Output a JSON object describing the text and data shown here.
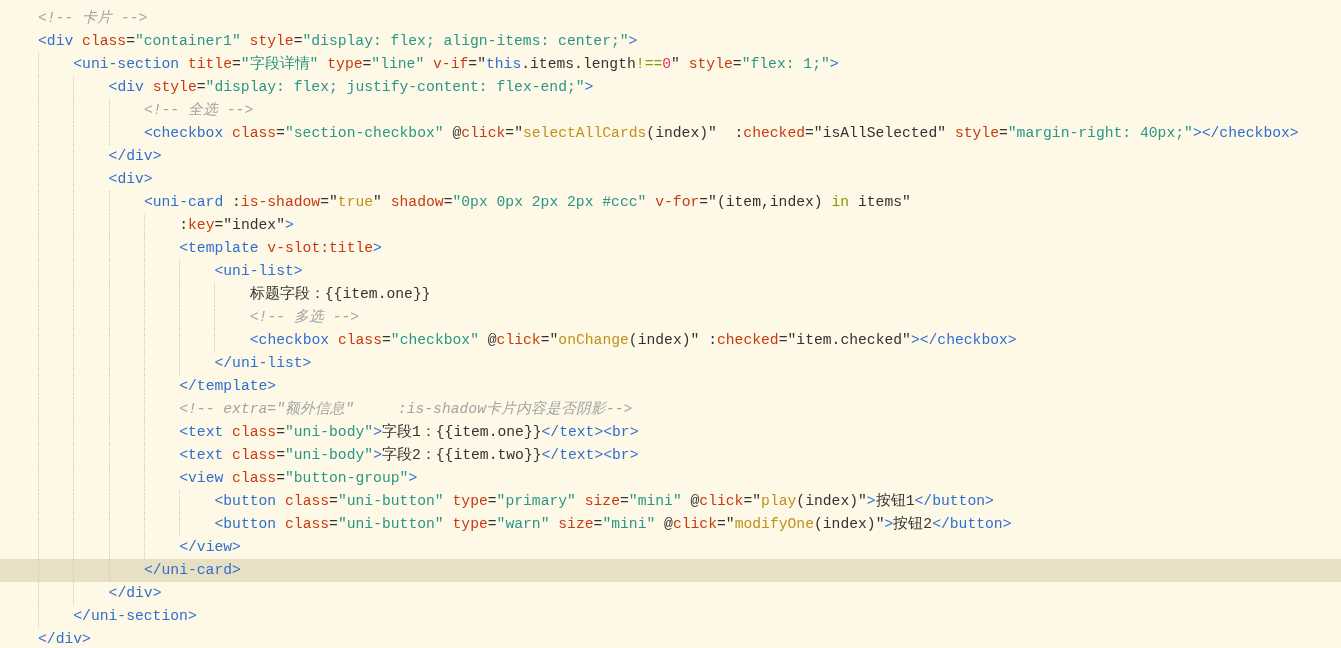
{
  "editor": {
    "lines": [
      {
        "t": [
          {
            "kind": "comment",
            "text": "<!-- 卡片 -->"
          }
        ]
      },
      {
        "t": [
          {
            "kind": "tag",
            "text": "<div"
          },
          {
            "kind": "attr",
            "text": " class"
          },
          {
            "kind": "plain",
            "text": "="
          },
          {
            "kind": "str",
            "text": "\"container1\""
          },
          {
            "kind": "attr",
            "text": " style"
          },
          {
            "kind": "plain",
            "text": "="
          },
          {
            "kind": "str",
            "text": "\"display: flex; align-items: center;\""
          },
          {
            "kind": "tag",
            "text": ">"
          }
        ],
        "children": [
          {
            "t": [
              {
                "kind": "tag",
                "text": "<uni-section"
              },
              {
                "kind": "attr",
                "text": " title"
              },
              {
                "kind": "plain",
                "text": "="
              },
              {
                "kind": "str",
                "text": "\"字段详情\""
              },
              {
                "kind": "attr",
                "text": " type"
              },
              {
                "kind": "plain",
                "text": "="
              },
              {
                "kind": "str",
                "text": "\"line\""
              },
              {
                "kind": "attr",
                "text": " v-if"
              },
              {
                "kind": "plain",
                "text": "=\""
              },
              {
                "kind": "this",
                "text": "this"
              },
              {
                "kind": "plain",
                "text": ".items.length"
              },
              {
                "kind": "kw",
                "text": "!=="
              },
              {
                "kind": "num",
                "text": "0"
              },
              {
                "kind": "plain",
                "text": "\""
              },
              {
                "kind": "attr",
                "text": " style"
              },
              {
                "kind": "plain",
                "text": "="
              },
              {
                "kind": "str",
                "text": "\"flex: 1;\""
              },
              {
                "kind": "tag",
                "text": ">"
              }
            ],
            "children": [
              {
                "t": [
                  {
                    "kind": "tag",
                    "text": "<div"
                  },
                  {
                    "kind": "attr",
                    "text": " style"
                  },
                  {
                    "kind": "plain",
                    "text": "="
                  },
                  {
                    "kind": "str",
                    "text": "\"display: flex; justify-content: flex-end;\""
                  },
                  {
                    "kind": "tag",
                    "text": ">"
                  }
                ],
                "children": [
                  {
                    "t": [
                      {
                        "kind": "comment",
                        "text": "<!-- 全选 -->"
                      }
                    ]
                  },
                  {
                    "t": [
                      {
                        "kind": "tag",
                        "text": "<checkbox"
                      },
                      {
                        "kind": "attr",
                        "text": " class"
                      },
                      {
                        "kind": "plain",
                        "text": "="
                      },
                      {
                        "kind": "str",
                        "text": "\"section-checkbox\""
                      },
                      {
                        "kind": "plain",
                        "text": " @"
                      },
                      {
                        "kind": "attr",
                        "text": "click"
                      },
                      {
                        "kind": "plain",
                        "text": "=\""
                      },
                      {
                        "kind": "fn",
                        "text": "selectAllCards"
                      },
                      {
                        "kind": "plain",
                        "text": "(index)\"  :"
                      },
                      {
                        "kind": "attr",
                        "text": "checked"
                      },
                      {
                        "kind": "plain",
                        "text": "=\"isAllSelected\""
                      },
                      {
                        "kind": "attr",
                        "text": " style"
                      },
                      {
                        "kind": "plain",
                        "text": "="
                      },
                      {
                        "kind": "str",
                        "text": "\"margin-right: 40px;\""
                      },
                      {
                        "kind": "tag",
                        "text": "></checkbox>"
                      }
                    ]
                  }
                ]
              },
              {
                "t": [
                  {
                    "kind": "tag",
                    "text": "</div>"
                  }
                ]
              },
              {
                "t": [
                  {
                    "kind": "tag",
                    "text": "<div>"
                  }
                ],
                "children": [
                  {
                    "t": [
                      {
                        "kind": "tag",
                        "text": "<uni-card"
                      },
                      {
                        "kind": "plain",
                        "text": " :"
                      },
                      {
                        "kind": "attr",
                        "text": "is-shadow"
                      },
                      {
                        "kind": "plain",
                        "text": "=\""
                      },
                      {
                        "kind": "fn",
                        "text": "true"
                      },
                      {
                        "kind": "plain",
                        "text": "\""
                      },
                      {
                        "kind": "attr",
                        "text": " shadow"
                      },
                      {
                        "kind": "plain",
                        "text": "="
                      },
                      {
                        "kind": "str",
                        "text": "\"0px 0px 2px 2px #ccc\""
                      },
                      {
                        "kind": "attr",
                        "text": " v-for"
                      },
                      {
                        "kind": "plain",
                        "text": "=\"(item,index) "
                      },
                      {
                        "kind": "kw",
                        "text": "in"
                      },
                      {
                        "kind": "plain",
                        "text": " items\""
                      }
                    ],
                    "children": [
                      {
                        "t": [
                          {
                            "kind": "plain",
                            "text": ":"
                          },
                          {
                            "kind": "attr",
                            "text": "key"
                          },
                          {
                            "kind": "plain",
                            "text": "=\"index\""
                          },
                          {
                            "kind": "tag",
                            "text": ">"
                          }
                        ]
                      },
                      {
                        "t": [
                          {
                            "kind": "tag",
                            "text": "<template"
                          },
                          {
                            "kind": "attr",
                            "text": " v-slot:title"
                          },
                          {
                            "kind": "tag",
                            "text": ">"
                          }
                        ],
                        "children": [
                          {
                            "t": [
                              {
                                "kind": "tag",
                                "text": "<uni-list>"
                              }
                            ],
                            "children": [
                              {
                                "t": [
                                  {
                                    "kind": "plain",
                                    "text": "标题字段：{{item.one}}"
                                  }
                                ]
                              },
                              {
                                "t": [
                                  {
                                    "kind": "comment",
                                    "text": "<!-- 多选 -->"
                                  }
                                ]
                              },
                              {
                                "t": [
                                  {
                                    "kind": "tag",
                                    "text": "<checkbox"
                                  },
                                  {
                                    "kind": "attr",
                                    "text": " class"
                                  },
                                  {
                                    "kind": "plain",
                                    "text": "="
                                  },
                                  {
                                    "kind": "str",
                                    "text": "\"checkbox\""
                                  },
                                  {
                                    "kind": "plain",
                                    "text": " @"
                                  },
                                  {
                                    "kind": "attr",
                                    "text": "click"
                                  },
                                  {
                                    "kind": "plain",
                                    "text": "=\""
                                  },
                                  {
                                    "kind": "fn",
                                    "text": "onChange"
                                  },
                                  {
                                    "kind": "plain",
                                    "text": "(index)\" :"
                                  },
                                  {
                                    "kind": "attr",
                                    "text": "checked"
                                  },
                                  {
                                    "kind": "plain",
                                    "text": "=\"item.checked\""
                                  },
                                  {
                                    "kind": "tag",
                                    "text": "></checkbox>"
                                  }
                                ]
                              }
                            ]
                          },
                          {
                            "t": [
                              {
                                "kind": "tag",
                                "text": "</uni-list>"
                              }
                            ]
                          }
                        ]
                      },
                      {
                        "t": [
                          {
                            "kind": "tag",
                            "text": "</template>"
                          }
                        ]
                      },
                      {
                        "t": [
                          {
                            "kind": "comment",
                            "text": "<!-- extra=\"额外信息\"     :is-shadow卡片内容是否阴影-->"
                          }
                        ]
                      },
                      {
                        "t": [
                          {
                            "kind": "tag",
                            "text": "<text"
                          },
                          {
                            "kind": "attr",
                            "text": " class"
                          },
                          {
                            "kind": "plain",
                            "text": "="
                          },
                          {
                            "kind": "str",
                            "text": "\"uni-body\""
                          },
                          {
                            "kind": "tag",
                            "text": ">"
                          },
                          {
                            "kind": "plain",
                            "text": "字段1：{{item.one}}"
                          },
                          {
                            "kind": "tag",
                            "text": "</text><br>"
                          }
                        ]
                      },
                      {
                        "t": [
                          {
                            "kind": "tag",
                            "text": "<text"
                          },
                          {
                            "kind": "attr",
                            "text": " class"
                          },
                          {
                            "kind": "plain",
                            "text": "="
                          },
                          {
                            "kind": "str",
                            "text": "\"uni-body\""
                          },
                          {
                            "kind": "tag",
                            "text": ">"
                          },
                          {
                            "kind": "plain",
                            "text": "字段2：{{item.two}}"
                          },
                          {
                            "kind": "tag",
                            "text": "</text><br>"
                          }
                        ]
                      },
                      {
                        "t": [
                          {
                            "kind": "tag",
                            "text": "<view"
                          },
                          {
                            "kind": "attr",
                            "text": " class"
                          },
                          {
                            "kind": "plain",
                            "text": "="
                          },
                          {
                            "kind": "str",
                            "text": "\"button-group\""
                          },
                          {
                            "kind": "tag",
                            "text": ">"
                          }
                        ],
                        "children": [
                          {
                            "t": [
                              {
                                "kind": "tag",
                                "text": "<button"
                              },
                              {
                                "kind": "attr",
                                "text": " class"
                              },
                              {
                                "kind": "plain",
                                "text": "="
                              },
                              {
                                "kind": "str",
                                "text": "\"uni-button\""
                              },
                              {
                                "kind": "attr",
                                "text": " type"
                              },
                              {
                                "kind": "plain",
                                "text": "="
                              },
                              {
                                "kind": "str",
                                "text": "\"primary\""
                              },
                              {
                                "kind": "attr",
                                "text": " size"
                              },
                              {
                                "kind": "plain",
                                "text": "="
                              },
                              {
                                "kind": "str",
                                "text": "\"mini\""
                              },
                              {
                                "kind": "plain",
                                "text": " @"
                              },
                              {
                                "kind": "attr",
                                "text": "click"
                              },
                              {
                                "kind": "plain",
                                "text": "=\""
                              },
                              {
                                "kind": "fn",
                                "text": "play"
                              },
                              {
                                "kind": "plain",
                                "text": "(index)\""
                              },
                              {
                                "kind": "tag",
                                "text": ">"
                              },
                              {
                                "kind": "plain",
                                "text": "按钮1"
                              },
                              {
                                "kind": "tag",
                                "text": "</button>"
                              }
                            ]
                          },
                          {
                            "t": [
                              {
                                "kind": "tag",
                                "text": "<button"
                              },
                              {
                                "kind": "attr",
                                "text": " class"
                              },
                              {
                                "kind": "plain",
                                "text": "="
                              },
                              {
                                "kind": "str",
                                "text": "\"uni-button\""
                              },
                              {
                                "kind": "attr",
                                "text": " type"
                              },
                              {
                                "kind": "plain",
                                "text": "="
                              },
                              {
                                "kind": "str",
                                "text": "\"warn\""
                              },
                              {
                                "kind": "attr",
                                "text": " size"
                              },
                              {
                                "kind": "plain",
                                "text": "="
                              },
                              {
                                "kind": "str",
                                "text": "\"mini\""
                              },
                              {
                                "kind": "plain",
                                "text": " @"
                              },
                              {
                                "kind": "attr",
                                "text": "click"
                              },
                              {
                                "kind": "plain",
                                "text": "=\""
                              },
                              {
                                "kind": "fn",
                                "text": "modifyOne"
                              },
                              {
                                "kind": "plain",
                                "text": "(index)\""
                              },
                              {
                                "kind": "tag",
                                "text": ">"
                              },
                              {
                                "kind": "plain",
                                "text": "按钮2"
                              },
                              {
                                "kind": "tag",
                                "text": "</button>"
                              }
                            ]
                          }
                        ]
                      },
                      {
                        "t": [
                          {
                            "kind": "tag",
                            "text": "</view>"
                          }
                        ]
                      }
                    ]
                  },
                  {
                    "t": [
                      {
                        "kind": "tag",
                        "text": "</uni-card>"
                      }
                    ],
                    "current": true
                  }
                ]
              },
              {
                "t": [
                  {
                    "kind": "tag",
                    "text": "</div>"
                  }
                ]
              }
            ]
          },
          {
            "t": [
              {
                "kind": "tag",
                "text": "</uni-section>"
              }
            ]
          }
        ]
      },
      {
        "t": [
          {
            "kind": "tag",
            "text": "</div>"
          }
        ]
      }
    ]
  }
}
